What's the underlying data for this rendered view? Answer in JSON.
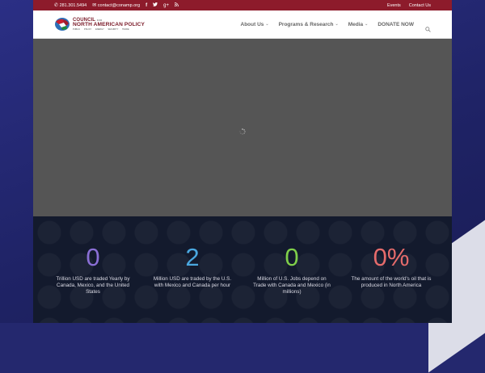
{
  "topbar": {
    "phone": "281.301.5494",
    "email": "contact@conamp.org",
    "links": [
      "Events",
      "Contact Us"
    ]
  },
  "logo": {
    "line1": "COUNCIL",
    "line1_small": "FOR",
    "line2": "NORTH AMERICAN POLICY",
    "tagline": "PUBLIC POLICY   ENERGY   SECURITY   TRADE"
  },
  "nav": {
    "items": [
      "About Us",
      "Programs & Research",
      "Media",
      "DONATE NOW"
    ]
  },
  "stats": [
    {
      "value": "0",
      "label": "Trillion USD are traded Yearly by Canada, Mexico, and the United States",
      "color": "#8a6fd6"
    },
    {
      "value": "2",
      "label": "Million USD are traded by the U.S. with Mexico and Canada per hour",
      "color": "#4aa8e0"
    },
    {
      "value": "0",
      "label": "Million of U.S. Jobs depend on Trade with Canada and Mexico (in millions)",
      "color": "#7fcf4a"
    },
    {
      "value": "0%",
      "label": "The amount of the world's oil that is produced in North America",
      "color": "#e56b6b"
    }
  ],
  "colors": {
    "topbar": "#8d1b2b",
    "brand": "#7a1a28",
    "hero": "#555555",
    "stats_bg": "#131a2d"
  }
}
